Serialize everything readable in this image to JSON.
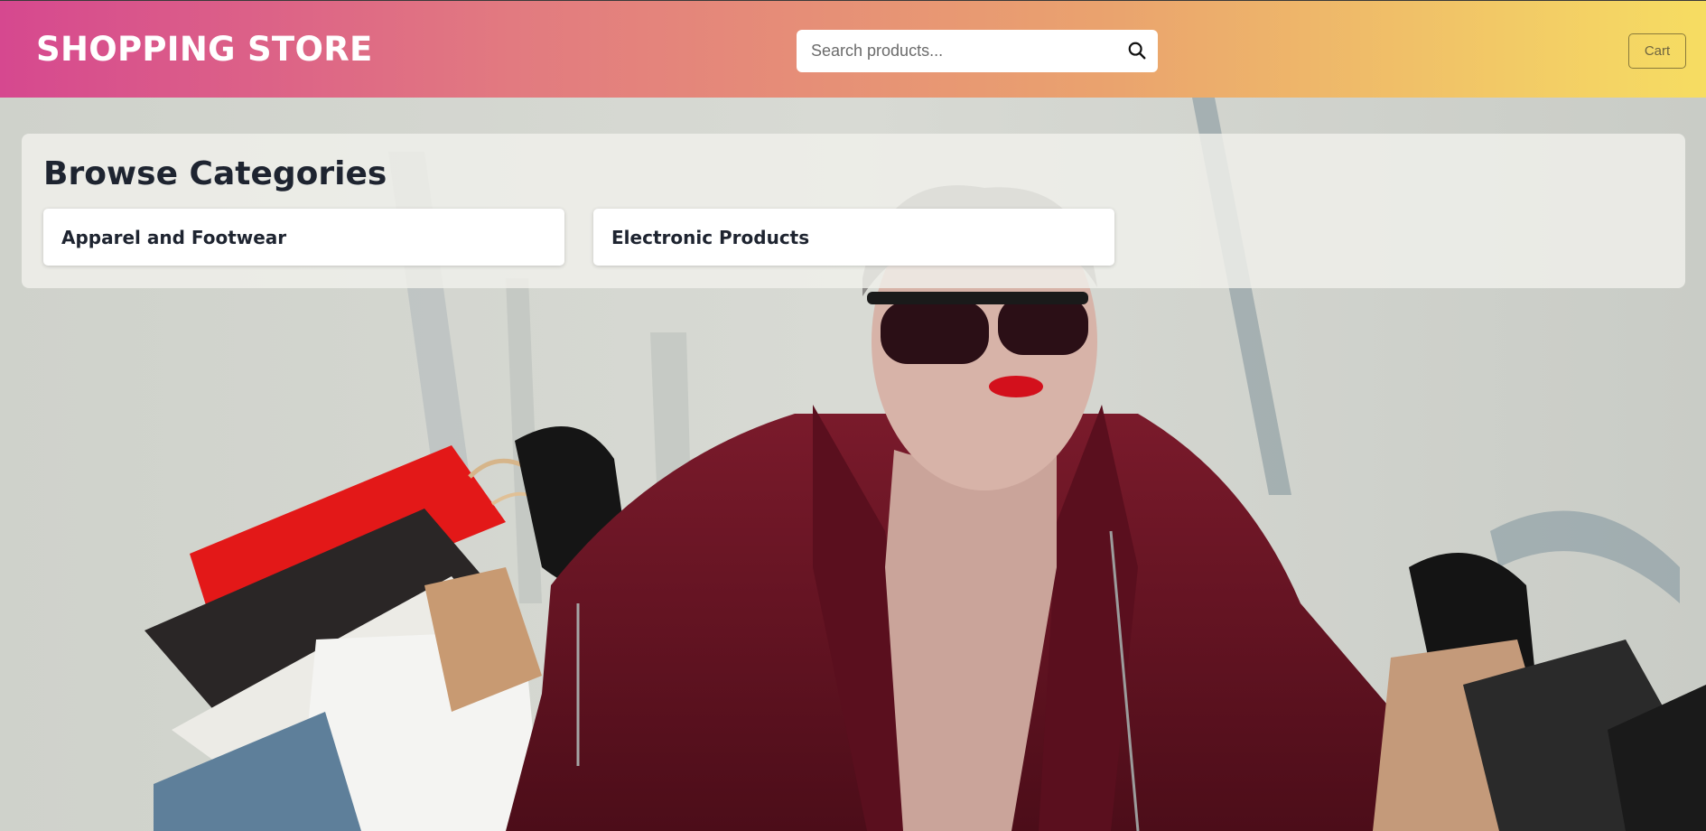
{
  "header": {
    "brand": "SHOPPING STORE",
    "search_placeholder": "Search products...",
    "search_icon": "search-icon",
    "cart_label": "Cart"
  },
  "categories": {
    "title": "Browse Categories",
    "items": [
      {
        "label": "Apparel and Footwear"
      },
      {
        "label": "Electronic Products"
      }
    ]
  },
  "colors": {
    "header_gradient": [
      "#d6488f",
      "#e27a80",
      "#eaa36e",
      "#f6dd62"
    ],
    "coat": "#6e1424",
    "title_text": "#1e2430"
  }
}
